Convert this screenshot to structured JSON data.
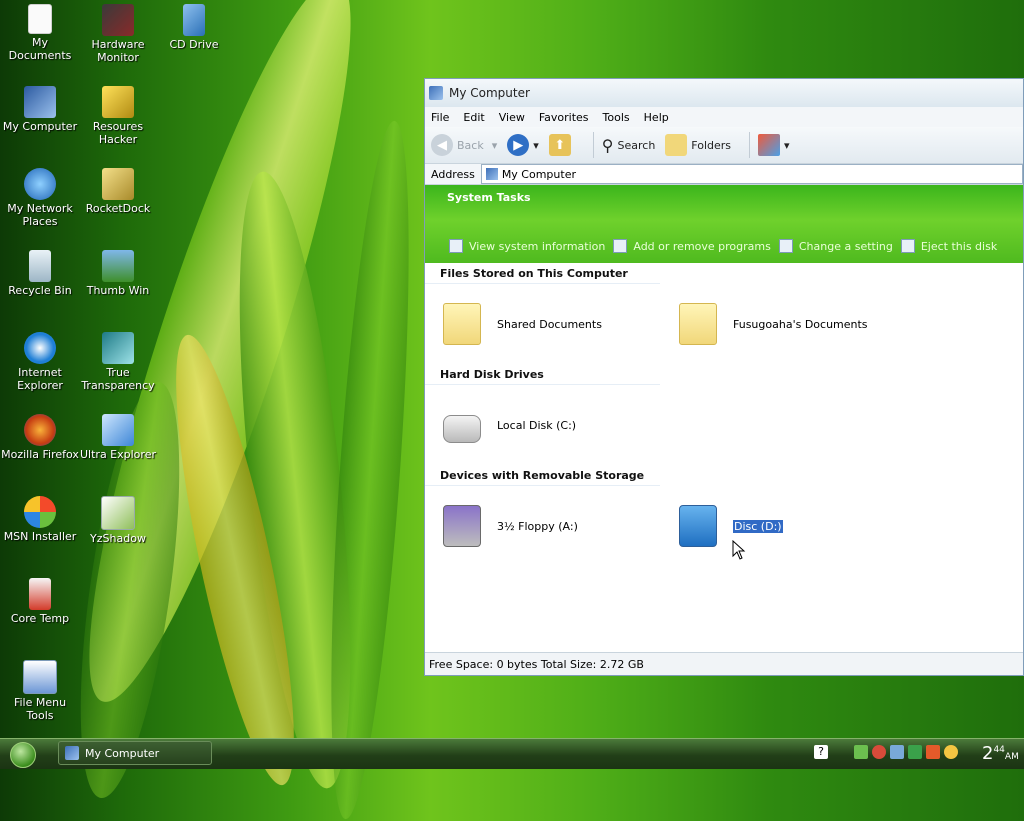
{
  "desktop": {
    "icons": [
      {
        "label": "My Documents"
      },
      {
        "label": "Hardware Monitor"
      },
      {
        "label": "CD Drive"
      },
      {
        "label": "My Computer"
      },
      {
        "label": "Resoures Hacker"
      },
      {
        "label": "My Network Places"
      },
      {
        "label": "RocketDock"
      },
      {
        "label": "Recycle Bin"
      },
      {
        "label": "Thumb Win"
      },
      {
        "label": "Internet Explorer"
      },
      {
        "label": "True Transparency"
      },
      {
        "label": "Mozilla Firefox"
      },
      {
        "label": "Ultra Explorer"
      },
      {
        "label": "MSN Installer"
      },
      {
        "label": "YzShadow"
      },
      {
        "label": "Core Temp"
      },
      {
        "label": "File Menu Tools"
      }
    ]
  },
  "window": {
    "title": "My Computer",
    "menu": [
      "File",
      "Edit",
      "View",
      "Favorites",
      "Tools",
      "Help"
    ],
    "toolbar": {
      "back": "Back",
      "search": "Search",
      "folders": "Folders"
    },
    "address": {
      "label": "Address",
      "value": "My Computer"
    },
    "system_tasks": {
      "title": "System Tasks",
      "items": [
        "View system information",
        "Add or remove programs",
        "Change a setting",
        "Eject this disk"
      ]
    },
    "sections": [
      {
        "title": "Files Stored on This Computer",
        "items": [
          "Shared Documents",
          "Fusugoaha's Documents"
        ]
      },
      {
        "title": "Hard Disk Drives",
        "items": [
          "Local Disk (C:)"
        ]
      },
      {
        "title": "Devices with Removable Storage",
        "items": [
          "3½ Floppy (A:)",
          "Disc (D:)"
        ]
      }
    ],
    "status": "Free Space: 0 bytes Total Size: 2.72 GB"
  },
  "taskbar": {
    "window_button": "My Computer",
    "clock_hour": "2",
    "clock_min": "44",
    "clock_ampm": "AM"
  },
  "colors": {
    "accent": "#316ac5",
    "task_green": "#4fba1f"
  }
}
